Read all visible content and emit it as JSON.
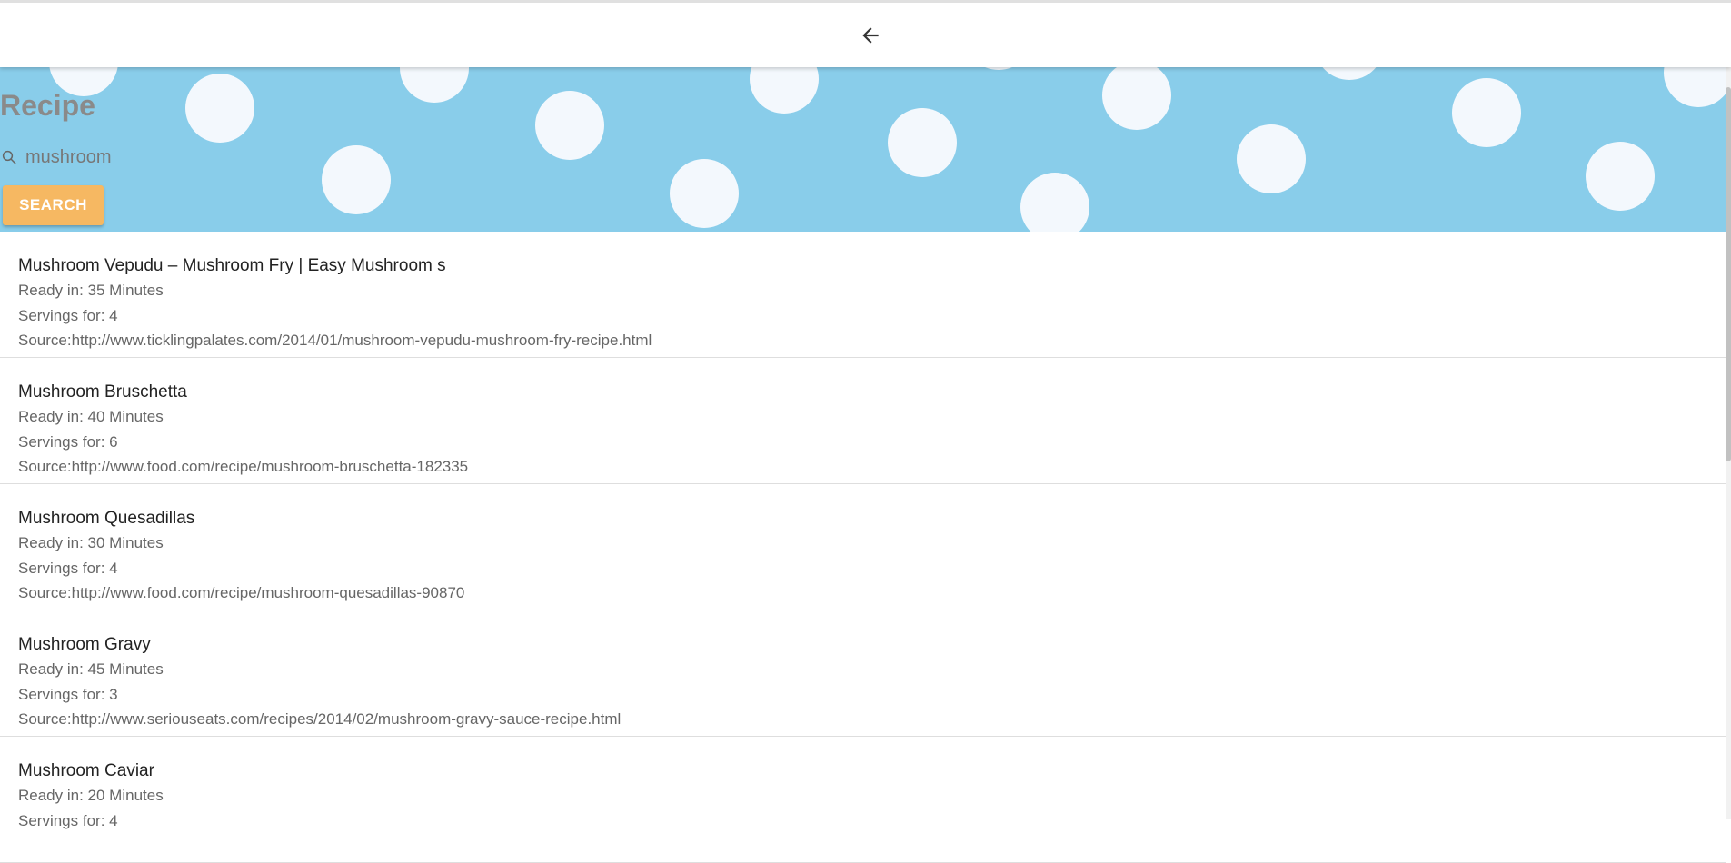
{
  "header": {
    "back_icon": "arrow-left-icon"
  },
  "hero": {
    "title": "Recipe",
    "search": {
      "icon": "search-icon",
      "value": "mushroom",
      "placeholder": ""
    },
    "search_button_label": "SEARCH",
    "colors": {
      "background": "#89cdea",
      "dots": "#f3f8fd",
      "button": "#f6b862",
      "title": "#8a8a8a"
    }
  },
  "results": [
    {
      "title": "Mushroom Vepudu – Mushroom Fry | Easy Mushroom s",
      "ready": "Ready in: 35 Minutes",
      "servings": "Servings for: 4",
      "source": "Source:http://www.ticklingpalates.com/2014/01/mushroom-vepudu-mushroom-fry-recipe.html"
    },
    {
      "title": "Mushroom Bruschetta",
      "ready": "Ready in: 40 Minutes",
      "servings": "Servings for: 6",
      "source": "Source:http://www.food.com/recipe/mushroom-bruschetta-182335"
    },
    {
      "title": "Mushroom Quesadillas",
      "ready": "Ready in: 30 Minutes",
      "servings": "Servings for: 4",
      "source": "Source:http://www.food.com/recipe/mushroom-quesadillas-90870"
    },
    {
      "title": "Mushroom Gravy",
      "ready": "Ready in: 45 Minutes",
      "servings": "Servings for: 3",
      "source": "Source:http://www.seriouseats.com/recipes/2014/02/mushroom-gravy-sauce-recipe.html"
    },
    {
      "title": "Mushroom Caviar",
      "ready": "Ready in: 20 Minutes",
      "servings": "Servings for: 4",
      "source": ""
    }
  ]
}
